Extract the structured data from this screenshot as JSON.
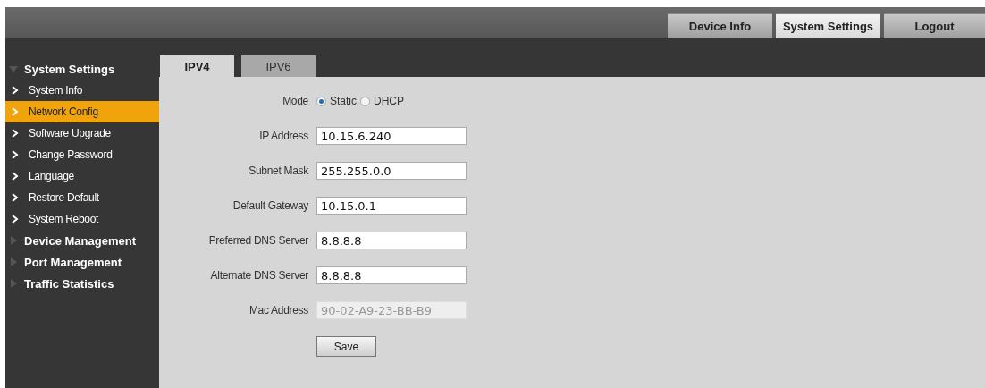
{
  "top_nav": [
    {
      "label": "Device Info",
      "selected": false
    },
    {
      "label": "System Settings",
      "selected": true
    },
    {
      "label": "Logout",
      "selected": false
    }
  ],
  "sidebar": [
    {
      "label": "System Settings",
      "expanded": true,
      "children": [
        {
          "label": "System Info",
          "selected": false
        },
        {
          "label": "Network Config",
          "selected": true
        },
        {
          "label": "Software Upgrade",
          "selected": false
        },
        {
          "label": "Change Password",
          "selected": false
        },
        {
          "label": "Language",
          "selected": false
        },
        {
          "label": "Restore Default",
          "selected": false
        },
        {
          "label": "System Reboot",
          "selected": false
        }
      ]
    },
    {
      "label": "Device Management",
      "expanded": false
    },
    {
      "label": "Port Management",
      "expanded": false
    },
    {
      "label": "Traffic Statistics",
      "expanded": false
    }
  ],
  "tabs": [
    {
      "label": "IPV4",
      "selected": true
    },
    {
      "label": "IPV6",
      "selected": false
    }
  ],
  "mode": {
    "label": "Mode",
    "options": [
      {
        "label": "Static",
        "selected": true
      },
      {
        "label": "DHCP",
        "selected": false
      }
    ]
  },
  "fields": [
    {
      "label": "IP Address",
      "value": "10.15.6.240",
      "disabled": false
    },
    {
      "label": "Subnet Mask",
      "value": "255.255.0.0",
      "disabled": false
    },
    {
      "label": "Default Gateway",
      "value": "10.15.0.1",
      "disabled": false
    },
    {
      "label": "Preferred DNS Server",
      "value": "8.8.8.8",
      "disabled": false
    },
    {
      "label": "Alternate DNS Server",
      "value": "8.8.8.8",
      "disabled": false
    },
    {
      "label": "Mac Address",
      "value": "90-02-A9-23-BB-B9",
      "disabled": true
    }
  ],
  "save_button": "Save"
}
